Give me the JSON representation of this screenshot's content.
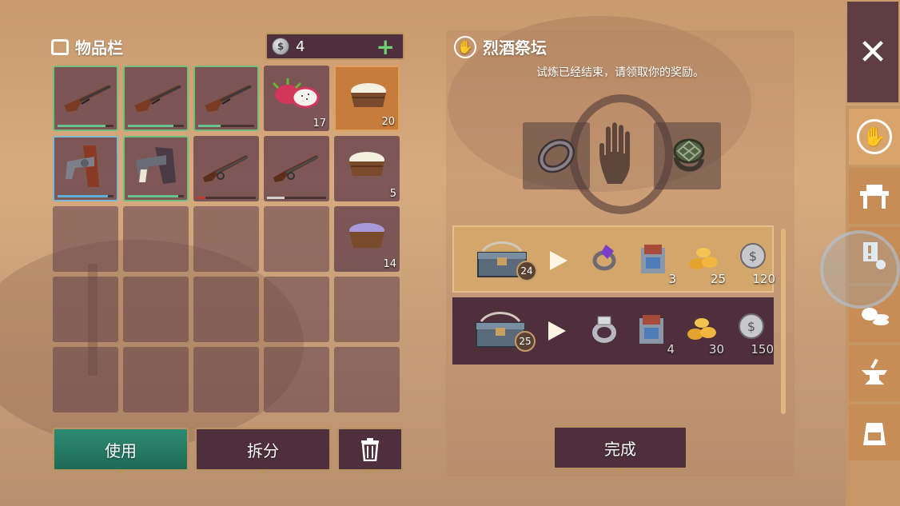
{
  "inventory": {
    "title": "物品栏",
    "currency_count": "4",
    "slots": [
      {
        "kind": "rifle",
        "border": "green",
        "durability": 0.85,
        "dur_color": "#66c48c"
      },
      {
        "kind": "rifle",
        "border": "green",
        "durability": 0.82,
        "dur_color": "#66c48c"
      },
      {
        "kind": "rifle",
        "border": "green",
        "durability": 0.4,
        "dur_color": "#66c48c"
      },
      {
        "kind": "dragonfruit",
        "qty": "17"
      },
      {
        "kind": "bowl-cream",
        "qty": "20",
        "border": "orange"
      },
      {
        "kind": "revolver-holster",
        "border": "blue",
        "durability": 0.9,
        "dur_color": "#5ab0d8"
      },
      {
        "kind": "revolver",
        "border": "green",
        "durability": 0.9,
        "dur_color": "#66c48c"
      },
      {
        "kind": "rifle-lever",
        "durability": 0.15,
        "dur_color": "#c23a2e"
      },
      {
        "kind": "rifle-lever",
        "durability": 0.3,
        "dur_color": "#d0d0d0"
      },
      {
        "kind": "bowl-cream",
        "qty": "5"
      },
      {},
      {},
      {},
      {},
      {
        "kind": "bowl-purple",
        "qty": "14"
      },
      {},
      {},
      {},
      {},
      {},
      {},
      {},
      {},
      {},
      {}
    ],
    "use_label": "使用",
    "split_label": "拆分"
  },
  "altar": {
    "title": "烈酒祭坛",
    "message": "试炼已经结束，请领取你的奖励。",
    "recipes": [
      {
        "level": "24",
        "rewards": [
          {
            "icon": "purple-ring-icon",
            "qty": ""
          },
          {
            "icon": "supply-pack-icon",
            "qty": "3"
          },
          {
            "icon": "gold-nuggets-icon",
            "qty": "25"
          },
          {
            "icon": "silver-coin-icon",
            "qty": "120"
          }
        ]
      },
      {
        "level": "25",
        "rewards": [
          {
            "icon": "silver-ring-icon",
            "qty": ""
          },
          {
            "icon": "supply-pack-icon",
            "qty": "4"
          },
          {
            "icon": "gold-nuggets-icon",
            "qty": "30"
          },
          {
            "icon": "silver-coin-icon",
            "qty": "150"
          }
        ]
      }
    ],
    "done_label": "完成"
  },
  "colors": {
    "panel_dark": "#4e2f3b",
    "accent_gold": "#b99262",
    "use_green": "#2f8b73",
    "plus_green": "#6fd07a"
  }
}
